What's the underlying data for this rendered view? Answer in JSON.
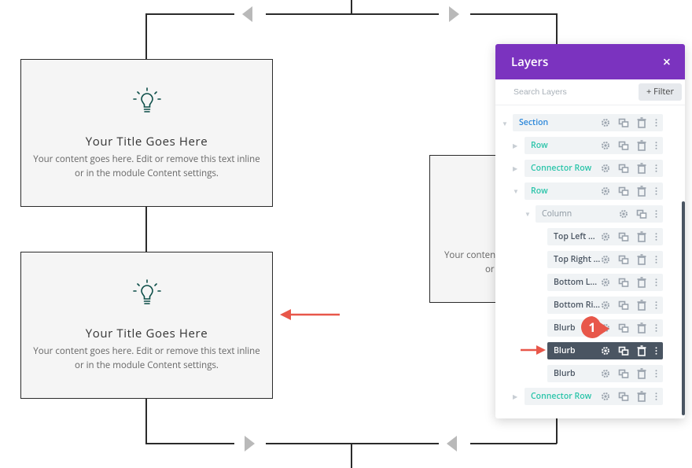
{
  "canvas": {
    "blurbs": [
      {
        "title": "Your Title Goes Here",
        "body_line1": "Your content goes here. Edit or remove this text inline",
        "body_line2": "or in the module Content settings."
      },
      {
        "title": "Your Title Goes Here",
        "body_line1": "Your content goes here. Edit or remove this text inline",
        "body_line2": "or in the module Content settings."
      }
    ],
    "partial_blurb": {
      "body_line1": "Your conten",
      "body_line2": "or"
    }
  },
  "layers_panel": {
    "title": "Layers",
    "close_label": "×",
    "search": {
      "placeholder": "Search Layers",
      "value": ""
    },
    "filter_label": "+ Filter",
    "items": [
      {
        "label": "Section",
        "type": "section"
      },
      {
        "label": "Row",
        "type": "row"
      },
      {
        "label": "Connector Row",
        "type": "row"
      },
      {
        "label": "Row",
        "type": "row"
      },
      {
        "label": "Column",
        "type": "column"
      },
      {
        "label": "Top Left ...",
        "type": "module"
      },
      {
        "label": "Top Right ...",
        "type": "module"
      },
      {
        "label": "Bottom L...",
        "type": "module"
      },
      {
        "label": "Bottom Ri...",
        "type": "module"
      },
      {
        "label": "Blurb",
        "type": "module"
      },
      {
        "label": "Blurb",
        "type": "module",
        "selected": true
      },
      {
        "label": "Blurb",
        "type": "module"
      },
      {
        "label": "Connector Row",
        "type": "row"
      }
    ]
  },
  "annotations": {
    "step_badge": "1"
  },
  "colors": {
    "panel_header": "#7b33bf",
    "section_label": "#2b87da",
    "row_label": "#29c4a9",
    "selected_row": "#4a5562",
    "annotation_red": "#e8574a",
    "bulb_icon": "#0b4d47"
  }
}
